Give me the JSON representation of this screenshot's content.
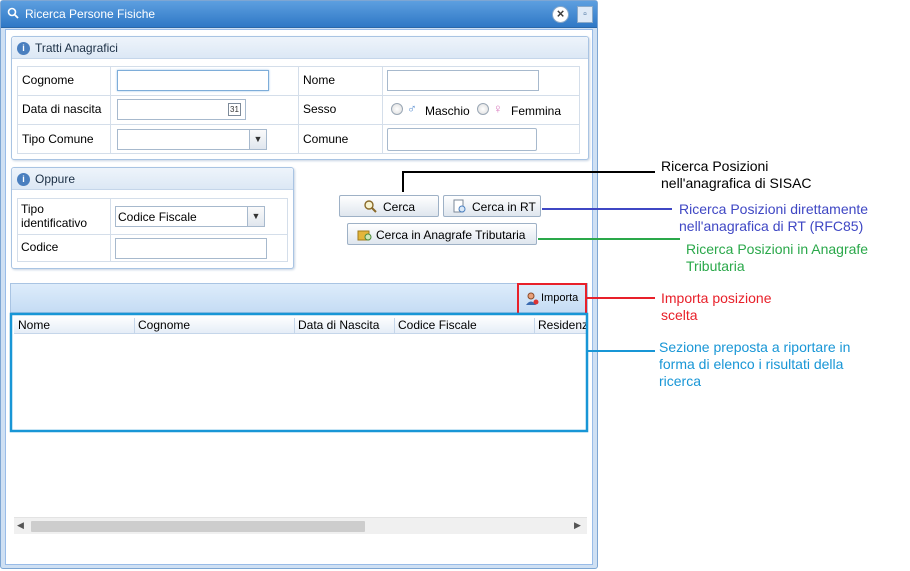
{
  "window": {
    "title": "Ricerca Persone Fisiche"
  },
  "tratti": {
    "legend": "Tratti Anagrafici",
    "cognome_label": "Cognome",
    "cognome_value": "",
    "nome_label": "Nome",
    "nome_value": "",
    "data_nascita_label": "Data di nascita",
    "data_nascita_value": "",
    "calendar_day": "31",
    "sesso_label": "Sesso",
    "maschio_label": "Maschio",
    "femmina_label": "Femmina",
    "tipo_comune_label": "Tipo Comune",
    "tipo_comune_value": "",
    "comune_label": "Comune",
    "comune_value": ""
  },
  "oppure": {
    "legend": "Oppure",
    "tipo_identificativo_label": "Tipo identificativo",
    "tipo_identificativo_value": "Codice Fiscale",
    "codice_label": "Codice",
    "codice_value": ""
  },
  "buttons": {
    "cerca": "Cerca",
    "cerca_rt": "Cerca in RT",
    "cerca_anagrafe": "Cerca in Anagrafe Tributaria",
    "importa": "Importa"
  },
  "results": {
    "columns": [
      "Nome",
      "Cognome",
      "Data di Nascita",
      "Codice Fiscale",
      "Residenza"
    ]
  },
  "annotations": {
    "cerca": [
      "Ricerca Posizioni",
      "nell'anagrafica di SISAC"
    ],
    "cerca_rt": [
      "Ricerca Posizioni direttamente",
      "nell'anagrafica di RT (RFC85)"
    ],
    "cerca_anagrafe": [
      "Ricerca Posizioni in Anagrafe",
      "Tributaria"
    ],
    "importa": [
      "Importa posizione",
      "scelta"
    ],
    "results": [
      "Sezione preposta a riportare in",
      "forma di elenco i risultati della",
      "ricerca"
    ]
  },
  "colors": {
    "black_annotation": "#000000",
    "blue_annotation": "#3f47c4",
    "green_annotation": "#2aa84a",
    "red_annotation": "#e8202a",
    "cyan_annotation": "#1896d6"
  }
}
